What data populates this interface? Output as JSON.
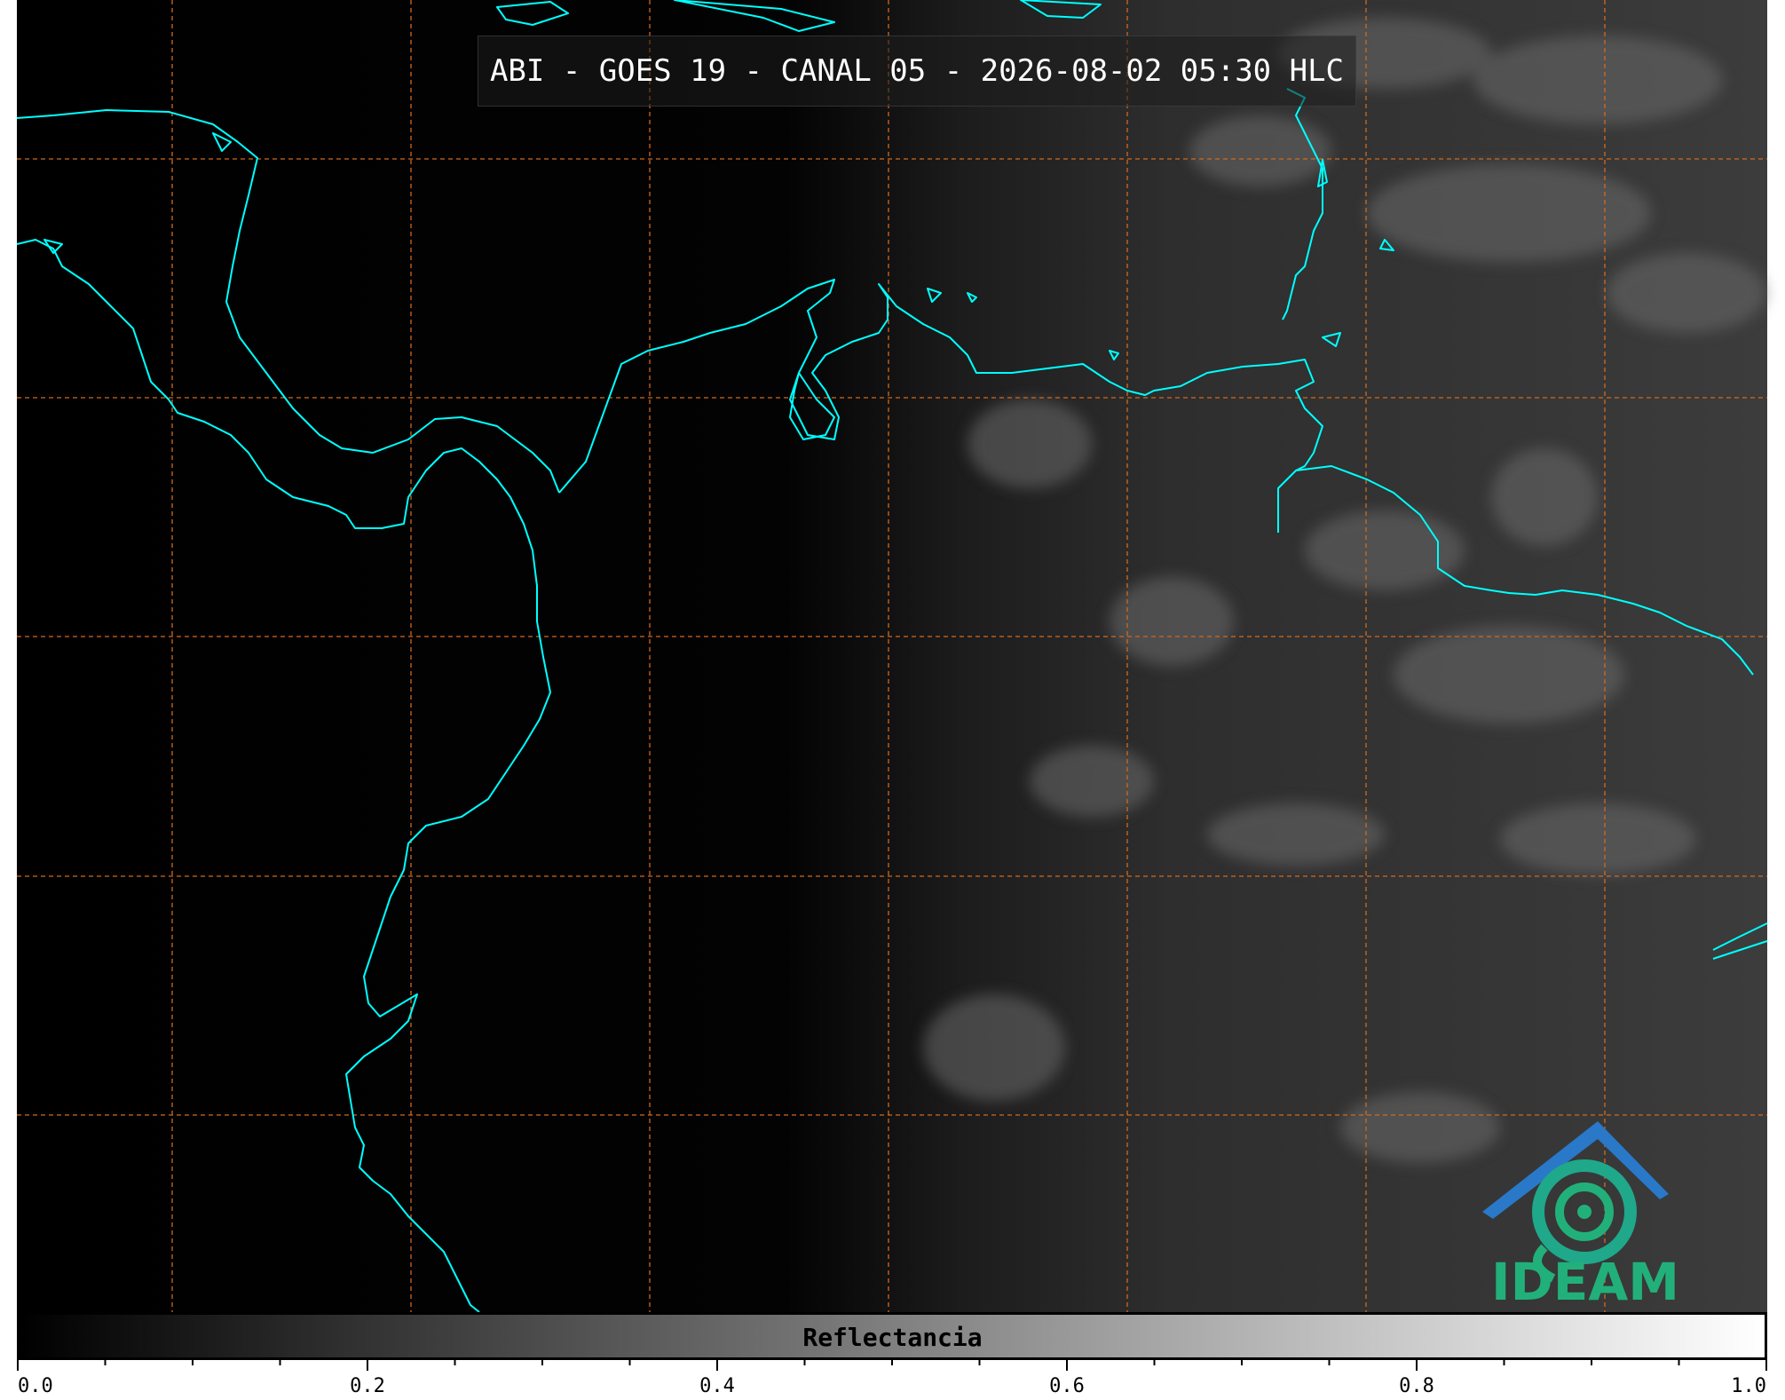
{
  "title": "ABI - GOES 19 - CANAL 05 - 2026-08-02 05:30 HLC",
  "logo": {
    "text": "IDEAM",
    "icon": "ideam-logo-icon",
    "colors": {
      "roof": "#2a78c8",
      "swirl": "#1fa88a",
      "text": "#22b07a"
    }
  },
  "colorbar": {
    "label": "Reflectancia",
    "min": 0.0,
    "max": 1.0,
    "tick_labels": [
      "0.0",
      "0.2",
      "0.4",
      "0.6",
      "0.8",
      "1.0"
    ],
    "colors": {
      "start": "#000000",
      "end": "#ffffff"
    }
  },
  "map": {
    "coastline_color": "#00ffff",
    "gridline_color": "#d2691e",
    "gridlines": "dashed"
  }
}
